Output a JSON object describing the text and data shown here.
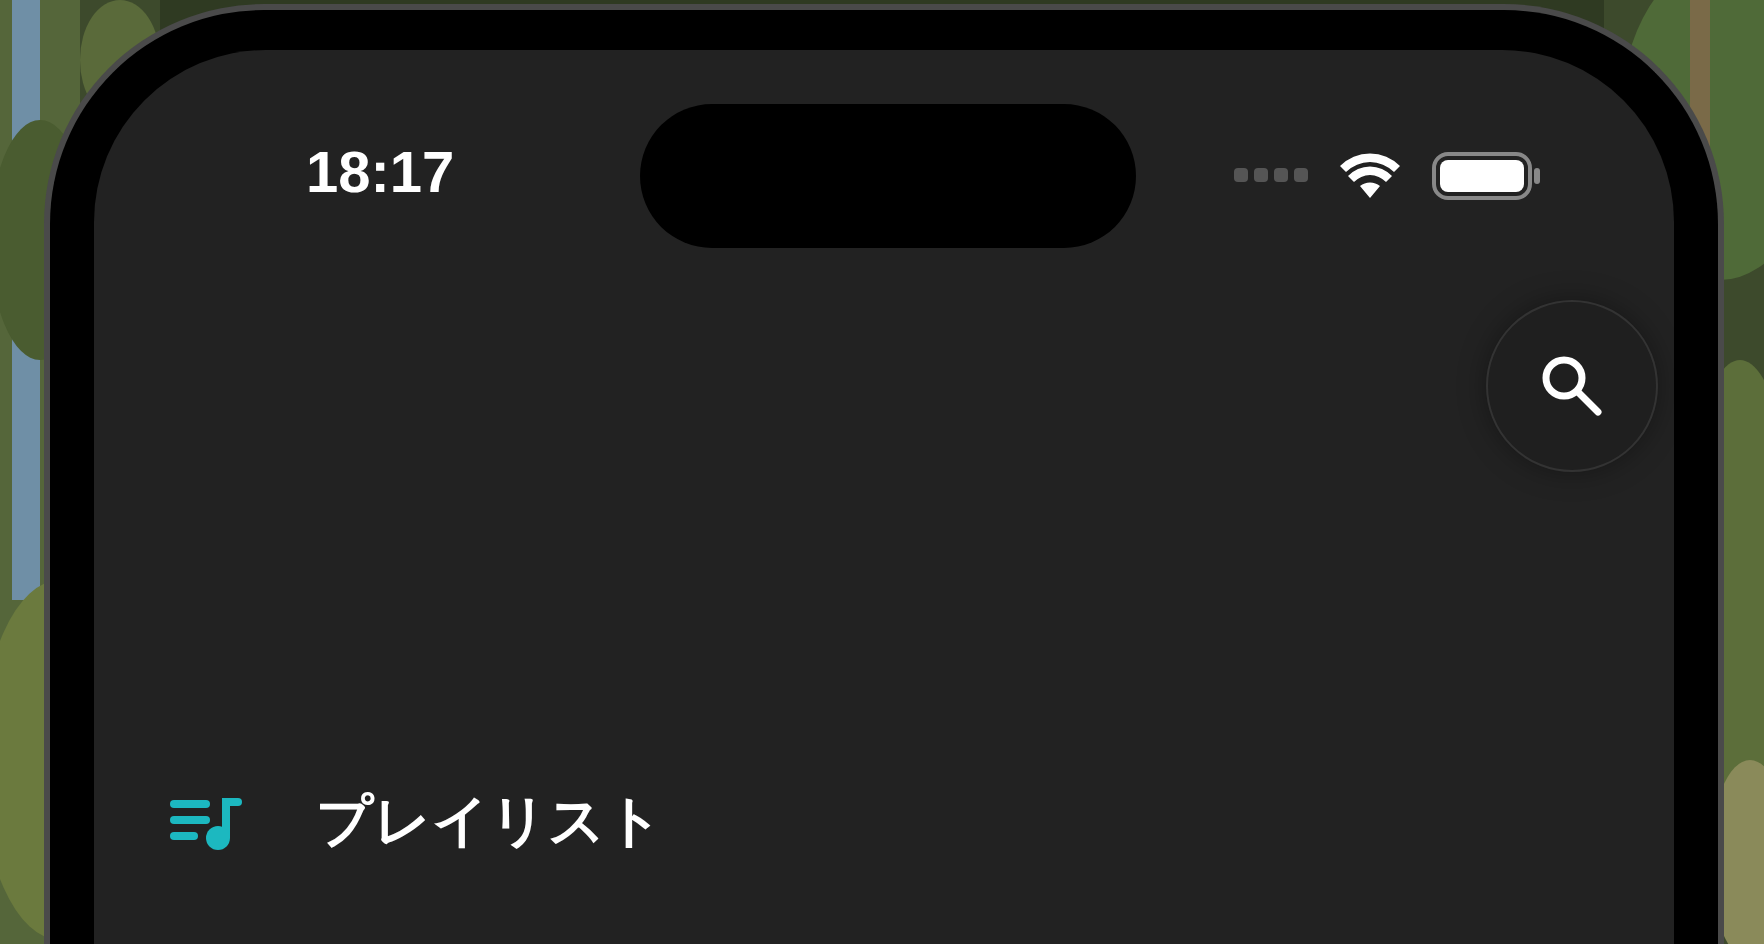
{
  "status_bar": {
    "time": "18:17"
  },
  "search_button": {
    "kind": "search"
  },
  "section": {
    "title": "プレイリスト"
  }
}
